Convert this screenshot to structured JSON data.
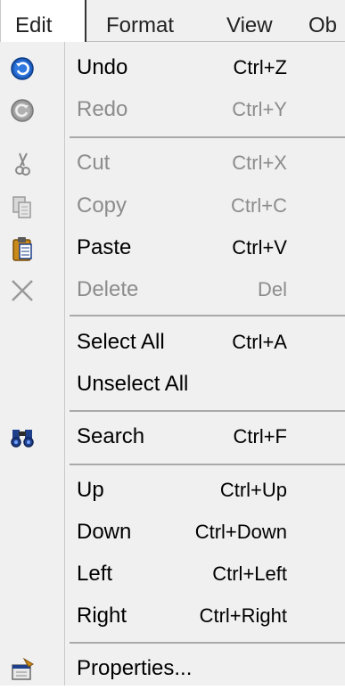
{
  "menubar": {
    "items": [
      "Edit",
      "Format",
      "View",
      "Ob"
    ]
  },
  "edit_menu": {
    "undo": {
      "label": "Undo",
      "shortcut": "Ctrl+Z",
      "icon": "undo-icon"
    },
    "redo": {
      "label": "Redo",
      "shortcut": "Ctrl+Y",
      "icon": "redo-icon"
    },
    "cut": {
      "label": "Cut",
      "shortcut": "Ctrl+X",
      "icon": "scissors-icon"
    },
    "copy": {
      "label": "Copy",
      "shortcut": "Ctrl+C",
      "icon": "copy-icon"
    },
    "paste": {
      "label": "Paste",
      "shortcut": "Ctrl+V",
      "icon": "clipboard-icon"
    },
    "delete": {
      "label": "Delete",
      "shortcut": "Del",
      "icon": "delete-x-icon"
    },
    "select_all": {
      "label": "Select All",
      "shortcut": "Ctrl+A"
    },
    "unselect_all": {
      "label": "Unselect All"
    },
    "search": {
      "label": "Search",
      "shortcut": "Ctrl+F",
      "icon": "binoculars-icon"
    },
    "up": {
      "label": "Up",
      "shortcut": "Ctrl+Up"
    },
    "down": {
      "label": "Down",
      "shortcut": "Ctrl+Down"
    },
    "left": {
      "label": "Left",
      "shortcut": "Ctrl+Left"
    },
    "right": {
      "label": "Right",
      "shortcut": "Ctrl+Right"
    },
    "properties": {
      "label": "Properties...",
      "icon": "properties-icon"
    }
  },
  "colors": {
    "undo_blue": "#1f5fbf",
    "disabled_text": "#8c8c8c",
    "menu_bg": "#f0f0f0"
  }
}
